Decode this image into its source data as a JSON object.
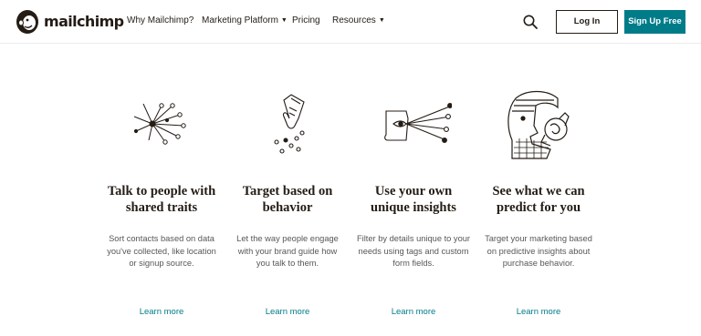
{
  "brand": {
    "name": "mailchimp",
    "accent": "#007c89",
    "text_color": "#241c15"
  },
  "nav": {
    "links": [
      {
        "label": "Why Mailchimp?",
        "has_dropdown": false
      },
      {
        "label": "Marketing Platform",
        "has_dropdown": true
      },
      {
        "label": "Pricing",
        "has_dropdown": false
      },
      {
        "label": "Resources",
        "has_dropdown": true
      }
    ],
    "search_icon": "search-icon",
    "login_label": "Log In",
    "signup_label": "Sign Up Free"
  },
  "features": [
    {
      "icon": "network-nodes-icon",
      "title": "Talk to people with shared traits",
      "description": "Sort contacts based on data you've collected, like location or signup source.",
      "link": "Learn more"
    },
    {
      "icon": "pointing-hand-icon",
      "title": "Target based on behavior",
      "description": "Let the way people engage with your brand guide how you talk to them.",
      "link": "Learn more"
    },
    {
      "icon": "eye-beams-icon",
      "title": "Use your own unique insights",
      "description": "Filter by details unique to your needs using tags and custom form fields.",
      "link": "Learn more"
    },
    {
      "icon": "fortune-teller-icon",
      "title": "See what we can predict for you",
      "description": "Target your marketing based on predictive insights about purchase behavior.",
      "link": "Learn more"
    }
  ]
}
